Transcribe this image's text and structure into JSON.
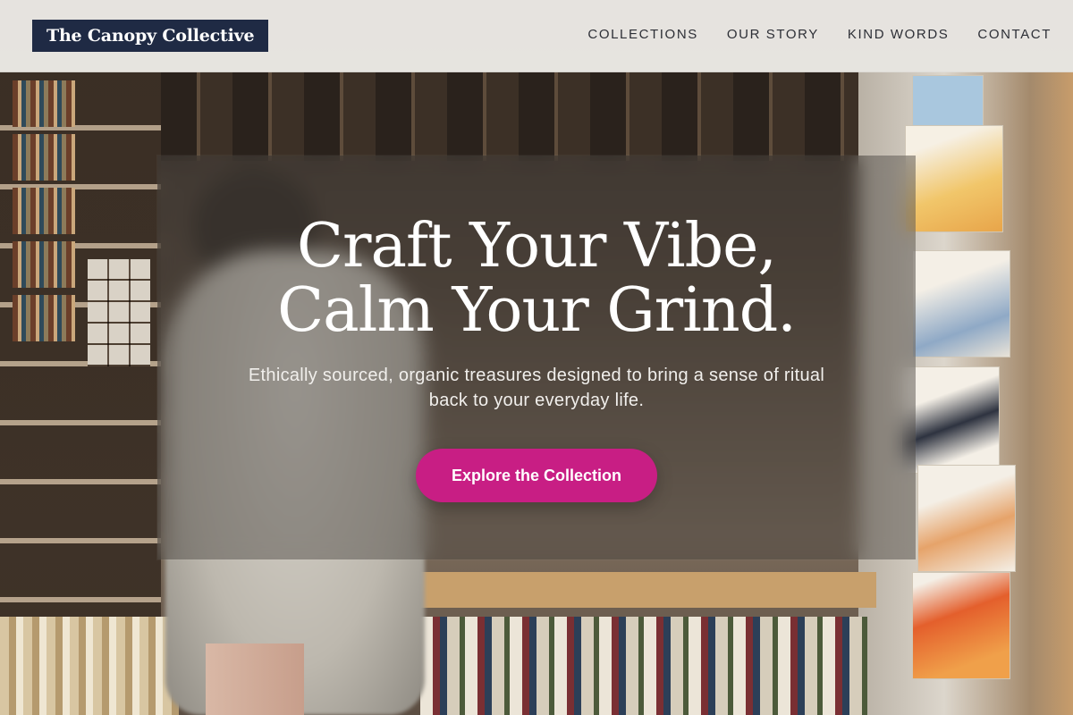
{
  "brand": {
    "name": "The Canopy Collective",
    "color": "#1f2a44"
  },
  "nav": {
    "items": [
      {
        "label": "COLLECTIONS"
      },
      {
        "label": "OUR STORY"
      },
      {
        "label": "KIND WORDS"
      },
      {
        "label": "CONTACT"
      }
    ]
  },
  "hero": {
    "title_line1": "Craft Your Vibe,",
    "title_line2": "Calm Your Grind.",
    "subtitle_line1": "Ethically sourced, organic treasures designed to bring a sense of ritual",
    "subtitle_line2": "back to your everyday life.",
    "cta_label": "Explore the Collection",
    "cta_color": "#c81e84"
  }
}
